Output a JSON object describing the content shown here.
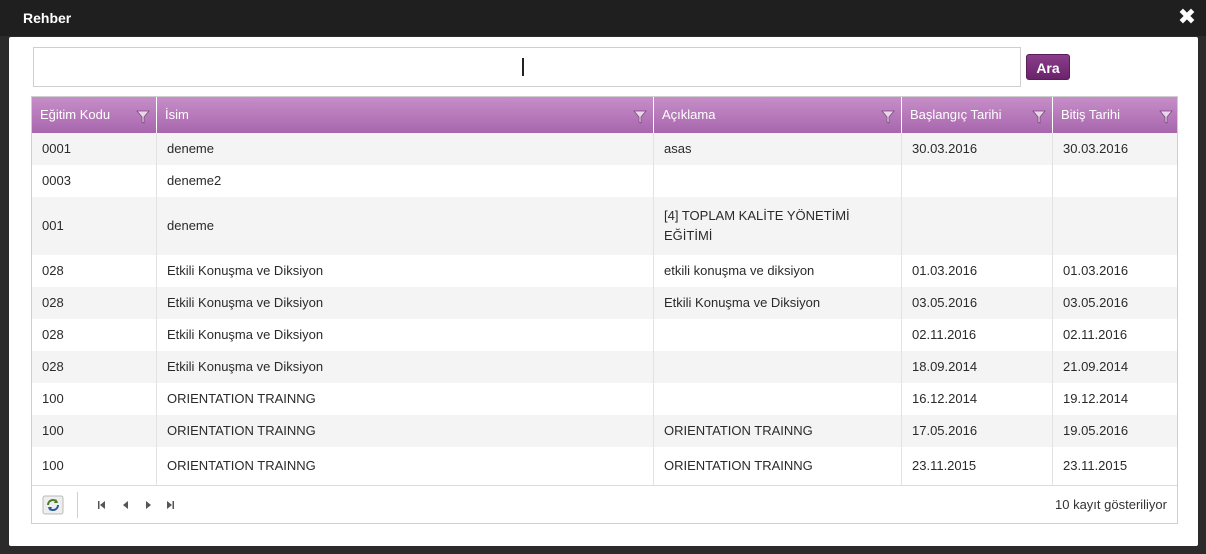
{
  "window": {
    "title": "Rehber",
    "close_icon": "close-icon"
  },
  "search": {
    "value": "",
    "placeholder": "",
    "button_label": "Ara"
  },
  "grid": {
    "columns": [
      {
        "label": "Eğitim Kodu",
        "icon": "filter-icon"
      },
      {
        "label": "İsim",
        "icon": "filter-icon"
      },
      {
        "label": "Açıklama",
        "icon": "filter-icon"
      },
      {
        "label": "Başlangıç Tarihi",
        "icon": "filter-icon"
      },
      {
        "label": "Bitiş Tarihi",
        "icon": "filter-icon"
      }
    ],
    "rows": [
      {
        "code": "0001",
        "name": "deneme",
        "desc": "asas",
        "start": "30.03.2016",
        "end": "30.03.2016"
      },
      {
        "code": "0003",
        "name": "deneme2",
        "desc": "",
        "start": "",
        "end": ""
      },
      {
        "code": "001",
        "name": "deneme",
        "desc": "[4] TOPLAM KALİTE YÖNETİMİ EĞİTİMİ",
        "start": "",
        "end": ""
      },
      {
        "code": "028",
        "name": "Etkili Konuşma ve Diksiyon",
        "desc": "etkili konuşma ve diksiyon",
        "start": "01.03.2016",
        "end": "01.03.2016"
      },
      {
        "code": "028",
        "name": "Etkili Konuşma ve Diksiyon",
        "desc": "Etkili Konuşma ve Diksiyon",
        "start": "03.05.2016",
        "end": "03.05.2016"
      },
      {
        "code": "028",
        "name": "Etkili Konuşma ve Diksiyon",
        "desc": "",
        "start": "02.11.2016",
        "end": "02.11.2016"
      },
      {
        "code": "028",
        "name": "Etkili Konuşma ve Diksiyon",
        "desc": "",
        "start": "18.09.2014",
        "end": "21.09.2014"
      },
      {
        "code": "100",
        "name": "ORIENTATION TRAINNG",
        "desc": "",
        "start": "16.12.2014",
        "end": "19.12.2014"
      },
      {
        "code": "100",
        "name": "ORIENTATION TRAINNG",
        "desc": "ORIENTATION TRAINNG",
        "start": "17.05.2016",
        "end": "19.05.2016"
      },
      {
        "code": "100",
        "name": "ORIENTATION TRAINNG",
        "desc": "ORIENTATION TRAINNG",
        "start": "23.11.2015",
        "end": "23.11.2015"
      }
    ]
  },
  "pager": {
    "refresh_icon": "refresh-icon",
    "first_icon": "first-page-icon",
    "prev_icon": "prev-page-icon",
    "next_icon": "next-page-icon",
    "last_icon": "last-page-icon",
    "info": "10 kayıt gösteriliyor"
  },
  "colors": {
    "header_top": "#c68ec8",
    "header_bottom": "#a866ad",
    "button": "#7a2e7a",
    "title_bar": "#1f1f1f"
  }
}
